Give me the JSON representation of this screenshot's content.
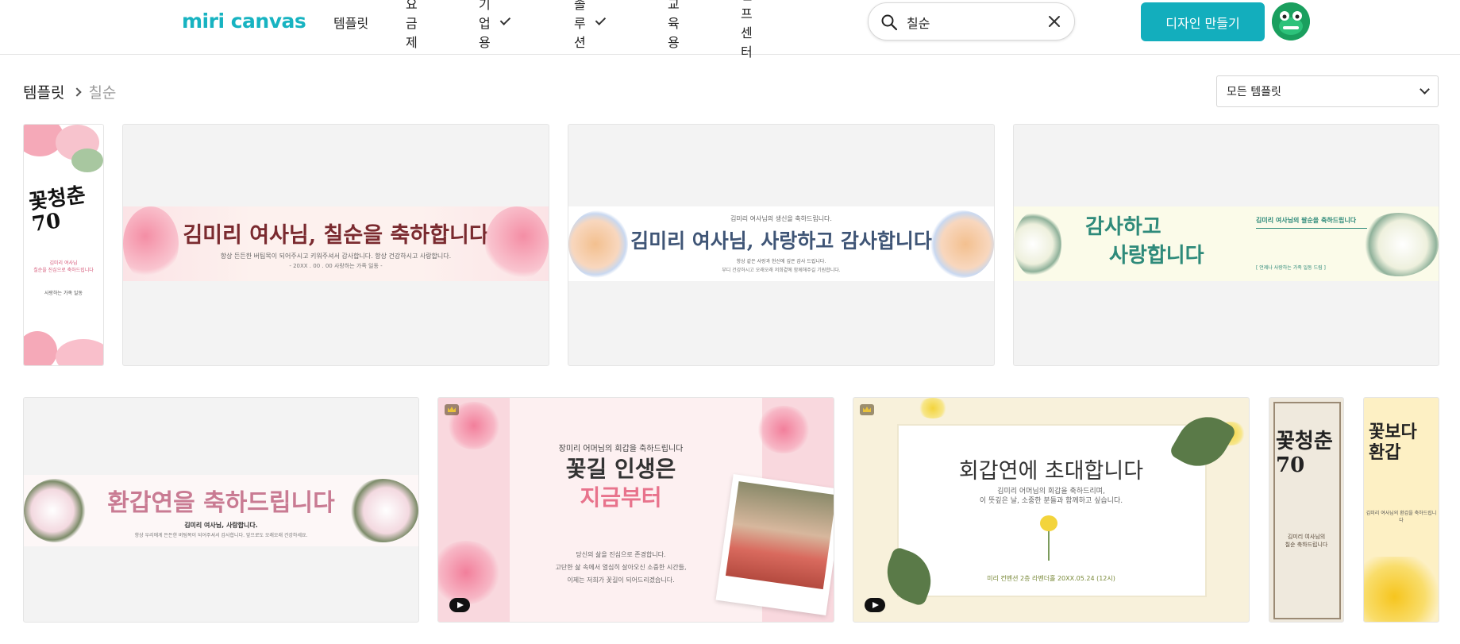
{
  "header": {
    "logo": "miri canvas",
    "nav": [
      {
        "label": "템플릿"
      },
      {
        "label": "요금제"
      },
      {
        "label": "기업용"
      },
      {
        "label": "솔루션"
      },
      {
        "label": "교육용"
      },
      {
        "label": "헬프센터"
      }
    ],
    "search": {
      "value": "칠순",
      "icon": "search-icon"
    },
    "make_button": "디자인 만들기",
    "accent": "#13aebd"
  },
  "breadcrumb": {
    "root": "템플릿",
    "current": "칠순"
  },
  "filter": {
    "selected": "모든 템플릿"
  },
  "templates_row1": [
    {
      "title": "꽃청춘 70",
      "lines": [
        "김미리 여사님",
        "칠순을 진심으로 축하드립니다",
        "사랑하는 가족 일동"
      ]
    },
    {
      "title": "김미리 여사님, 칠순을 축하합니다",
      "sub": "항상 든든한 버팀목이 되어주시고 키워주셔서 감사합니다. 항상 건강하시고 사랑합니다.",
      "small": "- 20XX . 00 . 00 사랑하는 가족 일동 -"
    },
    {
      "title": "김미리 여사님, 사랑하고 감사합니다",
      "top": "김미리 여사님의 생신을 축하드립니다.",
      "sub": "항상 같은 사랑과 헌신에 깊은 감사 드립니다.",
      "small": "부디 건강하시고 오래오래 저희곁에 함께해주길 기원합니다."
    },
    {
      "title_line1": "감사하고",
      "title_line2": "사랑합니다",
      "top": "김미리 여사님의 팔순을 축하드립니다",
      "small": "[ 언제나 사랑하는 가족 일동 드림 ]"
    }
  ],
  "templates_row2": [
    {
      "title": "환갑연을 축하드립니다",
      "sub": "김미리 여사님, 사랑합니다.",
      "small": "항상 우리에게 든든한 버팀목이 되어주셔서 감사합니다. 앞으로도 오래오래 건강하세요."
    },
    {
      "top": "장미리 어머님의 회갑을 축하드립니다",
      "title_line1": "꽃길 인생은",
      "title_line2": "지금부터",
      "lines": [
        "당신의 삶을 진심으로 존경합니다.",
        "고단한 삶 속에서 열심히 살아오신 소중한 시간들,",
        "이제는 저희가 꽃길이 되어드리겠습니다."
      ]
    },
    {
      "title": "회갑연에 초대합니다",
      "sub": "김미리 어머님의 회갑을 축하드리며,",
      "sub2": "이 뜻깊은 날, 소중한 분들과 함께하고 싶습니다.",
      "small": "미리 컨벤션 2층 라벤더홀 20XX.05.24 (12시)"
    },
    {
      "title": "꽃청춘 70",
      "lines": [
        "김미리 여사님의",
        "칠순 축하드립니다"
      ]
    },
    {
      "title": "꽃보다 환갑",
      "lines": [
        "김미리 여사님의 환갑을 축하드립니다"
      ]
    }
  ]
}
